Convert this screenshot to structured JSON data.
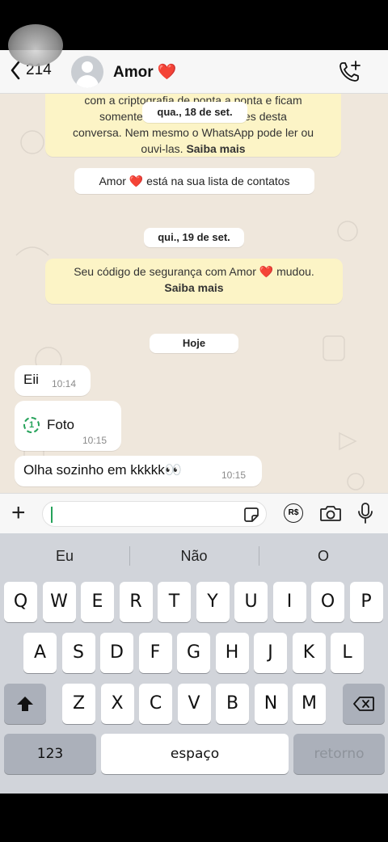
{
  "header": {
    "back_count": "214",
    "contact_name": "Amor",
    "contact_emoji": "❤️"
  },
  "chat": {
    "encryption_notice_line1": "com a criptografia de ponta a ponta e ficam",
    "encryption_notice_line2a": "somente entr",
    "encryption_notice_line2b": "pantes desta",
    "encryption_notice_line3": "conversa. Nem mesmo o WhatsApp pode ler ou",
    "encryption_notice_line4": "ouvi-las.",
    "encryption_learn_more": "Saiba mais",
    "date_1": "qua., 18 de set.",
    "contact_list_notice_a": "Amor",
    "contact_list_notice_b": "está na sua lista de contatos",
    "date_2": "qui., 19 de set.",
    "security_notice_a": "Seu código de segurança com Amor",
    "security_notice_b": "mudou.",
    "security_learn_more": "Saiba mais",
    "date_3": "Hoje",
    "messages": [
      {
        "text": "Eii",
        "time": "10:14"
      },
      {
        "text": "Foto",
        "time": "10:15",
        "view_once_label": "1"
      },
      {
        "text": "Olha sozinho em kkkkk👀",
        "time": "10:15"
      }
    ]
  },
  "composer": {
    "input_value": "",
    "payment_label": "R$"
  },
  "keyboard": {
    "suggestions": [
      "Eu",
      "Não",
      "O"
    ],
    "row1": [
      "Q",
      "W",
      "E",
      "R",
      "T",
      "Y",
      "U",
      "I",
      "O",
      "P"
    ],
    "row2": [
      "A",
      "S",
      "D",
      "F",
      "G",
      "H",
      "J",
      "K",
      "L"
    ],
    "row3": [
      "Z",
      "X",
      "C",
      "V",
      "B",
      "N",
      "M"
    ],
    "numbers_key": "123",
    "space_key": "espaço",
    "return_key": "retorno"
  }
}
